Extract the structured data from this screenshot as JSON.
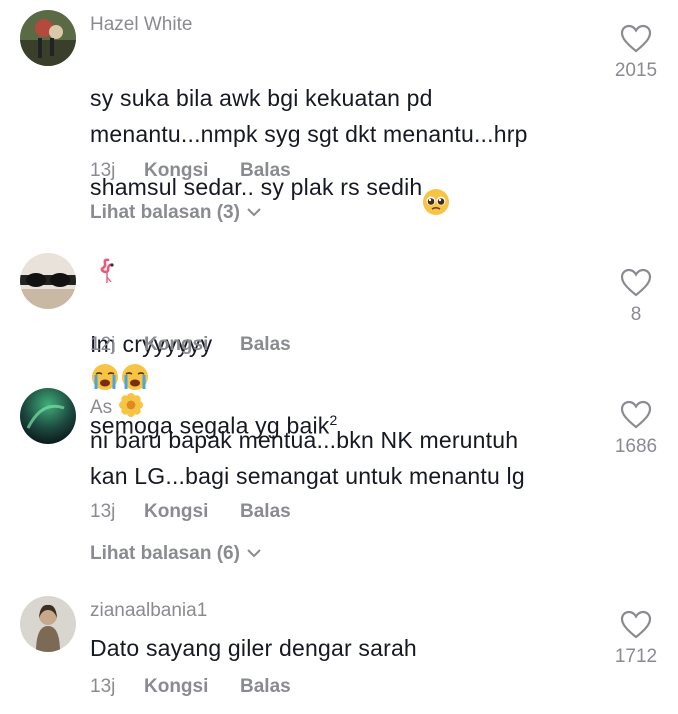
{
  "comments": [
    {
      "username": "Hazel White",
      "text_parts": [
        "sy suka bila awk bgi kekuatan pd\nmenantu...nmpk syg sgt dkt menantu...hrp\nshamsul sedar.. sy plak rs sedih"
      ],
      "time": "13j",
      "share": "Kongsi",
      "reply": "Balas",
      "view_replies": "Lihat balasan (3)",
      "likes": "2015",
      "avatar_colors": [
        "#3a3f2c",
        "#b44a3c",
        "#d8c9a8"
      ]
    },
    {
      "username": "",
      "username_icon": "flamingo-icon",
      "text_before": "Im cryyyyyy",
      "text_after": "semoga segala yg baik",
      "superscript": "2",
      "time": "12j",
      "share": "Kongsi",
      "reply": "Balas",
      "likes": "8"
    },
    {
      "username": "As",
      "username_icon": "flower-icon",
      "text_parts": [
        "ni baru bapak mentua...bkn NK meruntuh\nkan LG...bagi semangat untuk menantu lg"
      ],
      "time": "13j",
      "share": "Kongsi",
      "reply": "Balas",
      "view_replies": "Lihat balasan (6)",
      "likes": "1686"
    },
    {
      "username": "zianaalbania1",
      "text_parts": [
        "Dato sayang giler dengar sarah"
      ],
      "time": "13j",
      "share": "Kongsi",
      "reply": "Balas",
      "likes": "1712"
    }
  ],
  "icons": {
    "like": "heart-outline-icon",
    "chevron": "chevron-down-icon",
    "pleading": "pleading-face-emoji",
    "crying": "loudly-crying-face-emoji"
  }
}
